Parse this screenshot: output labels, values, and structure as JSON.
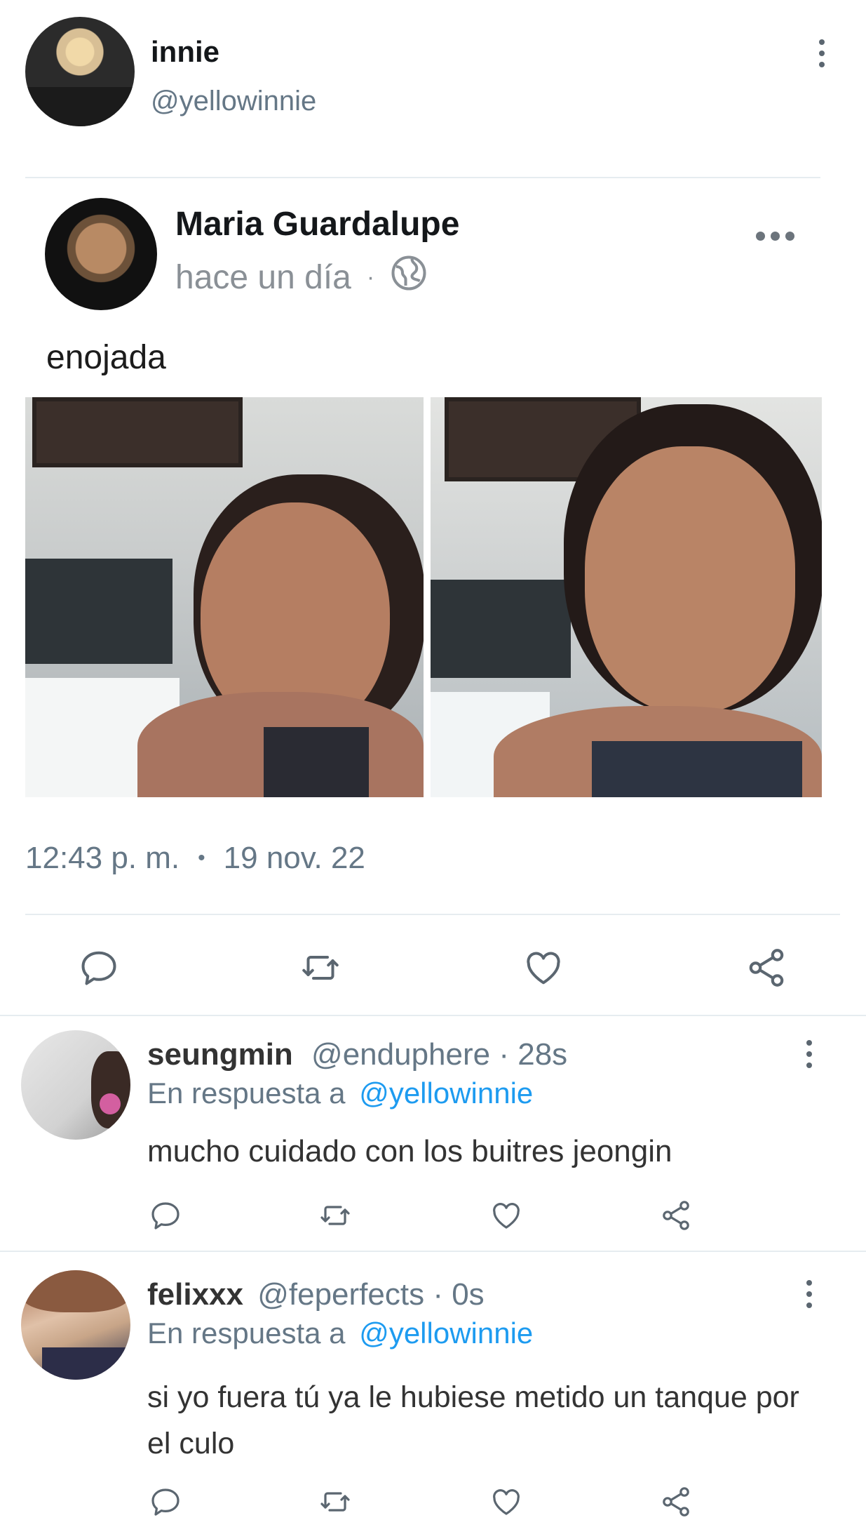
{
  "main_tweet": {
    "display_name": "innie",
    "handle": "@yellowinnie",
    "timestamp": "12:43 p. m.",
    "date": "19 nov. 22"
  },
  "embedded_post": {
    "author": "Maria Guardalupe",
    "time_ago": "hace un día",
    "separator": "·",
    "privacy_icon": "globe-icon",
    "text": "enojada"
  },
  "replies": [
    {
      "display_name": "seungmin",
      "handle_meta": "@enduphere · 28s",
      "reply_prefix": "En respuesta a",
      "reply_to": "@yellowinnie",
      "text": "mucho cuidado con los buitres jeongin"
    },
    {
      "display_name": "felixxx",
      "handle_meta": "@feperfects · 0s",
      "reply_prefix": "En respuesta a",
      "reply_to": "@yellowinnie",
      "text": "si yo fuera tú ya le hubiese metido un tanque por el culo"
    }
  ],
  "colors": {
    "accent": "#1d9bf0",
    "text_primary": "#14171a",
    "text_muted": "#657786",
    "icon": "#5b6670",
    "divider": "#e6ecf0"
  },
  "icons": [
    "more-vertical-icon",
    "more-horizontal-icon",
    "globe-icon",
    "reply-icon",
    "retweet-icon",
    "like-icon",
    "share-icon"
  ]
}
